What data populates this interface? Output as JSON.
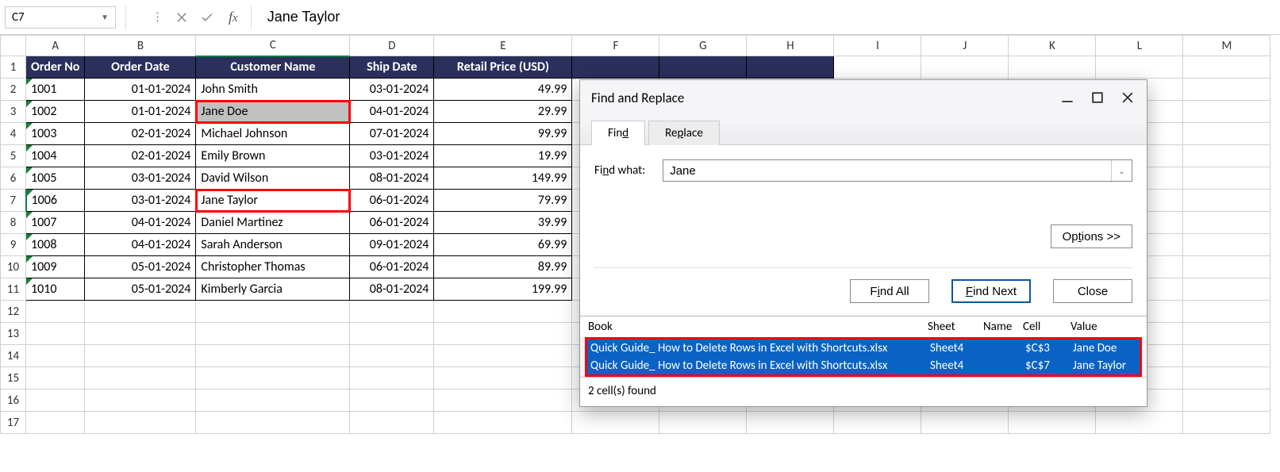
{
  "namebox": {
    "ref": "C7"
  },
  "formula_bar": {
    "value": "Jane Taylor"
  },
  "columns": [
    "A",
    "B",
    "C",
    "D",
    "E",
    "F",
    "G",
    "H",
    "I",
    "J",
    "K",
    "L",
    "M"
  ],
  "headers": {
    "A": "Order No",
    "B": "Order Date",
    "C": "Customer Name",
    "D": "Ship Date",
    "E": "Retail Price (USD)"
  },
  "rows": [
    {
      "A": "1001",
      "B": "01-01-2024",
      "C": "John Smith",
      "D": "03-01-2024",
      "E": "49.99"
    },
    {
      "A": "1002",
      "B": "01-01-2024",
      "C": "Jane Doe",
      "D": "04-01-2024",
      "E": "29.99"
    },
    {
      "A": "1003",
      "B": "02-01-2024",
      "C": "Michael Johnson",
      "D": "07-01-2024",
      "E": "99.99"
    },
    {
      "A": "1004",
      "B": "02-01-2024",
      "C": "Emily Brown",
      "D": "03-01-2024",
      "E": "19.99"
    },
    {
      "A": "1005",
      "B": "03-01-2024",
      "C": "David Wilson",
      "D": "08-01-2024",
      "E": "149.99"
    },
    {
      "A": "1006",
      "B": "03-01-2024",
      "C": "Jane Taylor",
      "D": "06-01-2024",
      "E": "79.99"
    },
    {
      "A": "1007",
      "B": "04-01-2024",
      "C": "Daniel Martinez",
      "D": "06-01-2024",
      "E": "39.99"
    },
    {
      "A": "1008",
      "B": "04-01-2024",
      "C": "Sarah Anderson",
      "D": "09-01-2024",
      "E": "69.99"
    },
    {
      "A": "1009",
      "B": "05-01-2024",
      "C": "Christopher Thomas",
      "D": "06-01-2024",
      "E": "89.99"
    },
    {
      "A": "1010",
      "B": "05-01-2024",
      "C": "Kimberly Garcia",
      "D": "08-01-2024",
      "E": "199.99"
    }
  ],
  "extra_row_count": 6,
  "redbox_cells": [
    "C3",
    "C7"
  ],
  "active_cell": "C7",
  "shaded_cell": "C3",
  "dialog": {
    "title": "Find and Replace",
    "tabs": {
      "find": "Find",
      "replace": "Replace",
      "active": "find"
    },
    "find_what_label": "Find what:",
    "find_what_value": "Jane",
    "options_label": "Options >>",
    "find_all_label": "Find All",
    "find_next_label": "Find Next",
    "close_label": "Close",
    "results_header": {
      "book": "Book",
      "sheet": "Sheet",
      "name": "Name",
      "cell": "Cell",
      "value": "Value"
    },
    "results": [
      {
        "book": "Quick Guide_ How to Delete Rows in Excel with Shortcuts.xlsx",
        "sheet": "Sheet4",
        "name": "",
        "cell": "$C$3",
        "value": "Jane Doe"
      },
      {
        "book": "Quick Guide_ How to Delete Rows in Excel with Shortcuts.xlsx",
        "sheet": "Sheet4",
        "name": "",
        "cell": "$C$7",
        "value": "Jane Taylor"
      }
    ],
    "status": "2 cell(s) found"
  }
}
